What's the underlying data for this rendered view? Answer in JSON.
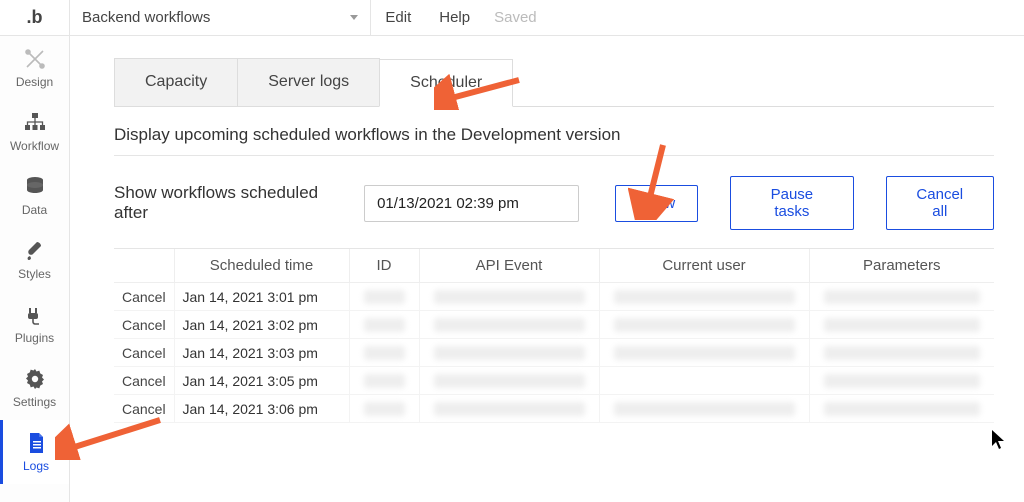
{
  "topbar": {
    "logo": ".b",
    "page_dropdown": "Backend workflows",
    "menu_edit": "Edit",
    "menu_help": "Help",
    "status": "Saved"
  },
  "sidebar": {
    "items": [
      {
        "label": "Design"
      },
      {
        "label": "Workflow"
      },
      {
        "label": "Data"
      },
      {
        "label": "Styles"
      },
      {
        "label": "Plugins"
      },
      {
        "label": "Settings"
      },
      {
        "label": "Logs"
      }
    ]
  },
  "tabs": {
    "capacity": "Capacity",
    "server_logs": "Server logs",
    "scheduler": "Scheduler"
  },
  "panel": {
    "description": "Display upcoming scheduled workflows in the Development version",
    "filter_label": "Show workflows scheduled after",
    "filter_value": "01/13/2021 02:39 pm",
    "show": "Show",
    "pause": "Pause tasks",
    "cancel_all": "Cancel all"
  },
  "table": {
    "headers": {
      "action": "",
      "scheduled_time": "Scheduled time",
      "id": "ID",
      "api_event": "API Event",
      "current_user": "Current user",
      "parameters": "Parameters"
    },
    "rows": [
      {
        "action": "Cancel",
        "time": "Jan 14, 2021 3:01 pm"
      },
      {
        "action": "Cancel",
        "time": "Jan 14, 2021 3:02 pm"
      },
      {
        "action": "Cancel",
        "time": "Jan 14, 2021 3:03 pm"
      },
      {
        "action": "Cancel",
        "time": "Jan 14, 2021 3:05 pm"
      },
      {
        "action": "Cancel",
        "time": "Jan 14, 2021 3:06 pm"
      }
    ]
  },
  "colors": {
    "accent": "#1a4de0",
    "arrow": "#ef6236"
  }
}
